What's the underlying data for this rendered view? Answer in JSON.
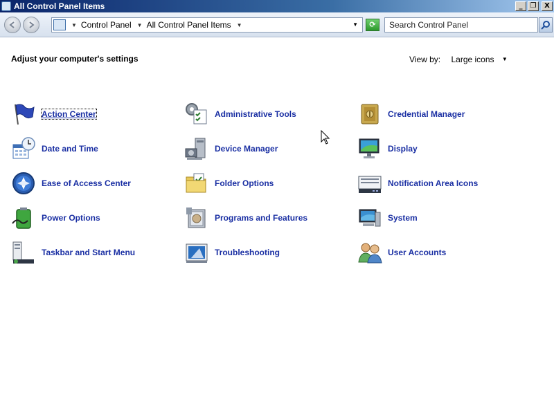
{
  "window": {
    "title": "All Control Panel Items",
    "min_label": "_",
    "restore_label": "❐",
    "close_label": "X"
  },
  "navbar": {
    "breadcrumbs": [
      "Control Panel",
      "All Control Panel Items"
    ],
    "search_placeholder": "Search Control Panel"
  },
  "content": {
    "heading": "Adjust your computer's settings",
    "view_by_label": "View by:",
    "view_by_value": "Large icons"
  },
  "items": [
    {
      "label": "Action Center",
      "icon": "flag-icon"
    },
    {
      "label": "Administrative Tools",
      "icon": "admin-tools-icon"
    },
    {
      "label": "Credential Manager",
      "icon": "vault-icon"
    },
    {
      "label": "Date and Time",
      "icon": "calendar-clock-icon"
    },
    {
      "label": "Device Manager",
      "icon": "device-manager-icon"
    },
    {
      "label": "Display",
      "icon": "monitor-icon"
    },
    {
      "label": "Ease of Access Center",
      "icon": "ease-of-access-icon"
    },
    {
      "label": "Folder Options",
      "icon": "folder-icon"
    },
    {
      "label": "Notification Area Icons",
      "icon": "notification-area-icon"
    },
    {
      "label": "Power Options",
      "icon": "battery-icon"
    },
    {
      "label": "Programs and Features",
      "icon": "programs-icon"
    },
    {
      "label": "System",
      "icon": "system-icon"
    },
    {
      "label": "Taskbar and Start Menu",
      "icon": "taskbar-icon"
    },
    {
      "label": "Troubleshooting",
      "icon": "troubleshoot-icon"
    },
    {
      "label": "User Accounts",
      "icon": "users-icon"
    }
  ],
  "colors": {
    "link": "#1a2fa3",
    "titlebar_start": "#0a246a",
    "titlebar_end": "#a6caf0"
  }
}
